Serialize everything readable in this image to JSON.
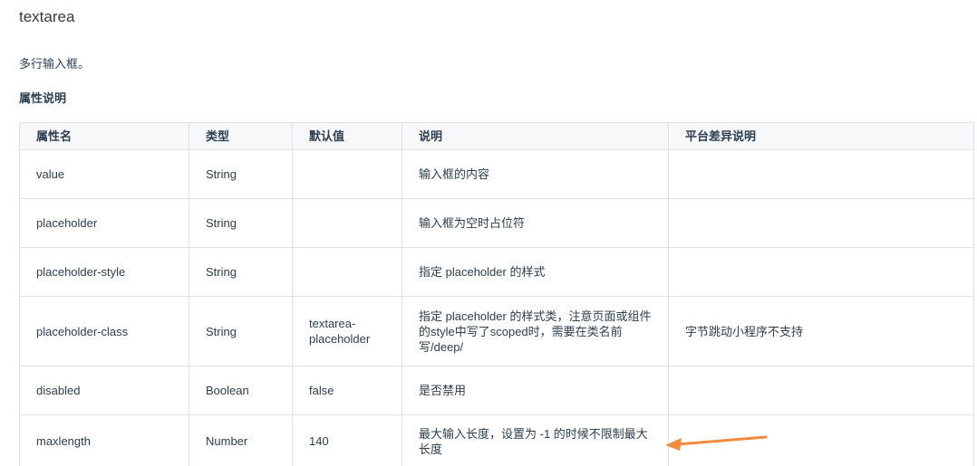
{
  "page": {
    "title": "textarea",
    "description": "多行输入框。",
    "section_title": "属性说明"
  },
  "table": {
    "headers": [
      "属性名",
      "类型",
      "默认值",
      "说明",
      "平台差异说明"
    ],
    "rows": [
      {
        "name": "value",
        "type": "String",
        "default": "",
        "desc": "输入框的内容",
        "platform": ""
      },
      {
        "name": "placeholder",
        "type": "String",
        "default": "",
        "desc": "输入框为空时占位符",
        "platform": ""
      },
      {
        "name": "placeholder-style",
        "type": "String",
        "default": "",
        "desc": "指定 placeholder 的样式",
        "platform": ""
      },
      {
        "name": "placeholder-class",
        "type": "String",
        "default": "textarea-placeholder",
        "desc": "指定 placeholder 的样式类，注意页面或组件的style中写了scoped时，需要在类名前写/deep/",
        "platform": "字节跳动小程序不支持"
      },
      {
        "name": "disabled",
        "type": "Boolean",
        "default": "false",
        "desc": "是否禁用",
        "platform": ""
      },
      {
        "name": "maxlength",
        "type": "Number",
        "default": "140",
        "desc": "最大输入长度，设置为 -1 的时候不限制最大长度",
        "platform": ""
      }
    ]
  },
  "annotation": {
    "arrow_color": "#f08a3c"
  }
}
